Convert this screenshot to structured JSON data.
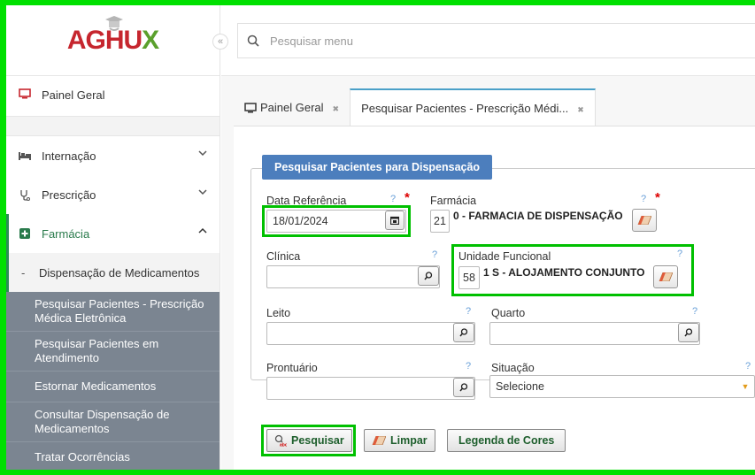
{
  "app": {
    "logo": {
      "prefix": "AGH",
      "u": "U",
      "x": "X"
    }
  },
  "sidebar": {
    "collapse_glyph": "«",
    "painel": "Painel Geral",
    "items": [
      {
        "label": "Internação",
        "icon": "bed-icon"
      },
      {
        "label": "Prescrição",
        "icon": "stethoscope-icon"
      },
      {
        "label": "Farmácia",
        "icon": "plus-square-icon"
      }
    ],
    "farmacia_sub": {
      "active": "Dispensação de Medicamentos",
      "items": [
        "Pesquisar Pacientes - Prescrição Médica Eletrônica",
        "Pesquisar Pacientes em Atendimento",
        "Estornar Medicamentos",
        "Consultar Dispensação de Medicamentos",
        "Tratar Ocorrências"
      ]
    }
  },
  "search": {
    "placeholder": "Pesquisar menu"
  },
  "tabs": [
    {
      "label": "Painel Geral"
    },
    {
      "label": "Pesquisar Pacientes - Prescrição Médi..."
    }
  ],
  "form": {
    "legend": "Pesquisar Pacientes para Dispensação",
    "help": "?",
    "required": "*",
    "data_referencia": {
      "label": "Data Referência",
      "value": "18/01/2024"
    },
    "farmacia": {
      "label": "Farmácia",
      "code": "21",
      "value": "0 - FARMACIA DE DISPENSAÇÃO"
    },
    "clinica": {
      "label": "Clínica",
      "value": ""
    },
    "unidade": {
      "label": "Unidade Funcional",
      "code": "58",
      "value": "1 S - ALOJAMENTO CONJUNTO"
    },
    "leito": {
      "label": "Leito",
      "value": ""
    },
    "quarto": {
      "label": "Quarto",
      "value": ""
    },
    "prontuario": {
      "label": "Prontuário",
      "value": ""
    },
    "situacao": {
      "label": "Situação",
      "value": "Selecione"
    }
  },
  "actions": {
    "pesquisar": "Pesquisar",
    "limpar": "Limpar",
    "legenda": "Legenda de Cores"
  },
  "colors": {
    "highlight": "#00c000",
    "legend_bg": "#4c7ebd",
    "submenu_bg": "#7b8591",
    "logo_red": "#c6262e",
    "logo_green": "#5aa02c"
  }
}
